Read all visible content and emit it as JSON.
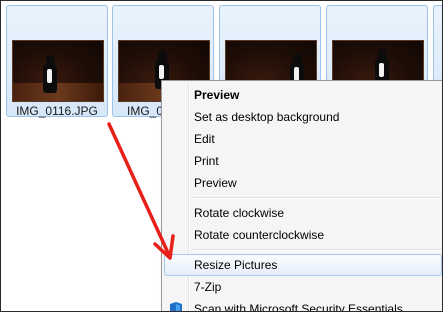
{
  "thumbnails": [
    {
      "label": "IMG_0116.JPG"
    },
    {
      "label": "IMG_0"
    },
    {
      "label": ""
    },
    {
      "label": ""
    }
  ],
  "context_menu": {
    "items": [
      {
        "label": "Preview",
        "bold": true
      },
      {
        "label": "Set as desktop background"
      },
      {
        "label": "Edit"
      },
      {
        "label": "Print"
      },
      {
        "label": "Preview"
      },
      {
        "label": "Rotate clockwise"
      },
      {
        "label": "Rotate counterclockwise"
      },
      {
        "label": "Resize Pictures",
        "highlighted": true
      },
      {
        "label": "7-Zip"
      },
      {
        "label": "Scan with Microsoft Security Essentials",
        "icon": "security-shield-icon"
      }
    ]
  },
  "annotation": {
    "arrow_color": "#e8201a"
  },
  "colors": {
    "selection_border": "#9cc3ea",
    "menu_background": "#f5f5f5",
    "highlight_border": "#aac8ee"
  }
}
